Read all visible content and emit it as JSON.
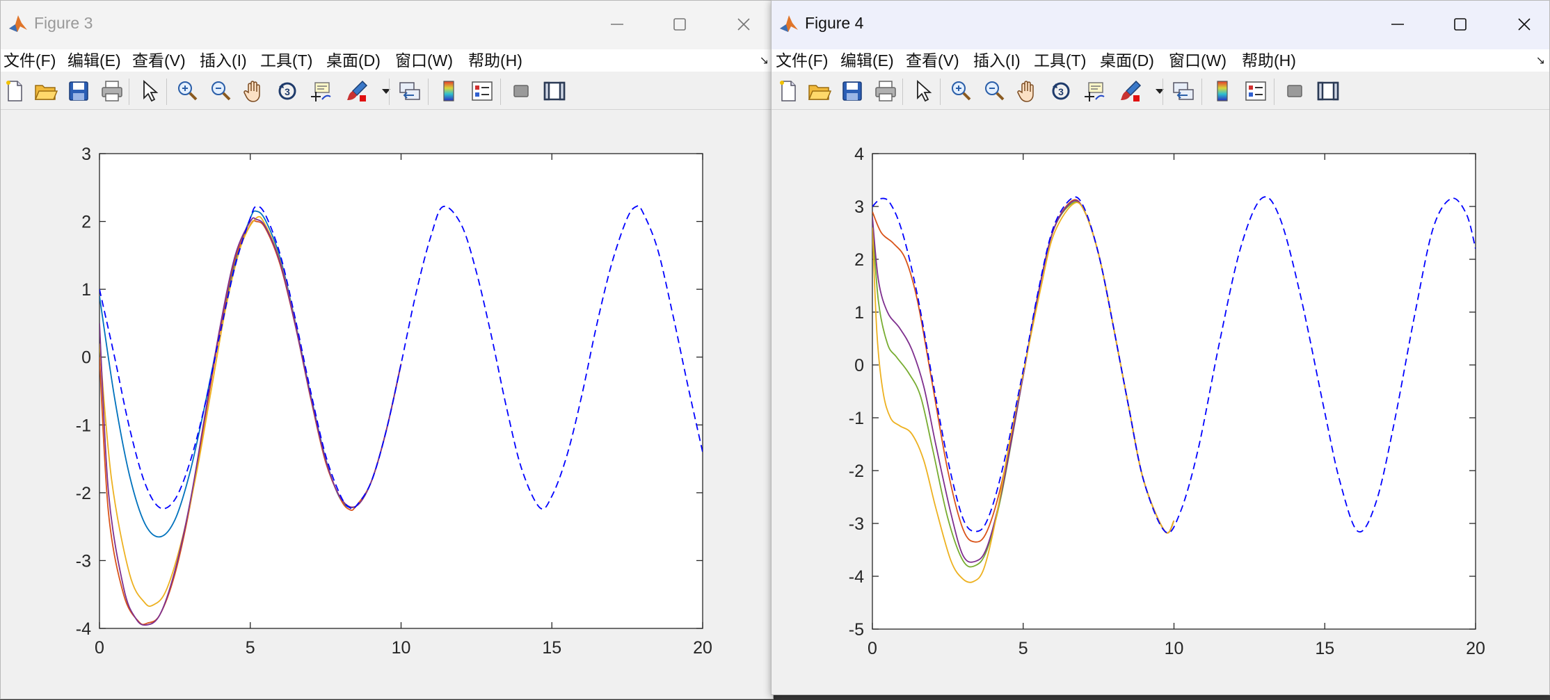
{
  "figures": [
    {
      "title": "Figure 3",
      "menu": [
        "文件(F)",
        "编辑(E)",
        "查看(V)",
        "插入(I)",
        "工具(T)",
        "桌面(D)",
        "窗口(W)",
        "帮助(H)"
      ],
      "toolbar": [
        "new-figure-icon",
        "open-file-icon",
        "save-icon",
        "print-icon",
        "pointer-icon",
        "zoom-in-icon",
        "zoom-out-icon",
        "pan-hand-icon",
        "rotate-3d-icon",
        "data-cursor-icon",
        "brush-icon",
        "brush-dropdown-icon",
        "link-plot-icon",
        "colorbar-icon",
        "legend-icon",
        "hide-plot-tools-icon",
        "show-plot-tools-icon"
      ],
      "controls": [
        "minimize-icon",
        "maximize-icon",
        "close-icon"
      ]
    },
    {
      "title": "Figure 4",
      "menu": [
        "文件(F)",
        "编辑(E)",
        "查看(V)",
        "插入(I)",
        "工具(T)",
        "桌面(D)",
        "窗口(W)",
        "帮助(H)"
      ],
      "toolbar": [
        "new-figure-icon",
        "open-file-icon",
        "save-icon",
        "print-icon",
        "pointer-icon",
        "zoom-in-icon",
        "zoom-out-icon",
        "pan-hand-icon",
        "rotate-3d-icon",
        "data-cursor-icon",
        "brush-icon",
        "brush-dropdown-icon",
        "link-plot-icon",
        "colorbar-icon",
        "legend-icon",
        "hide-plot-tools-icon",
        "show-plot-tools-icon"
      ],
      "controls": [
        "minimize-icon",
        "maximize-icon",
        "close-icon"
      ]
    }
  ],
  "chart_data": [
    {
      "type": "line",
      "title": "",
      "xlabel": "",
      "ylabel": "",
      "xlim": [
        0,
        20
      ],
      "ylim": [
        -4,
        3
      ],
      "xticks": [
        0,
        5,
        10,
        15,
        20
      ],
      "yticks": [
        -4,
        -3,
        -2,
        -1,
        0,
        1,
        2,
        3
      ],
      "grid": false,
      "series": [
        {
          "color": "#0000ff",
          "dash": true,
          "x": [
            0,
            0.5,
            1,
            1.5,
            2,
            2.5,
            3,
            3.5,
            4,
            4.5,
            5,
            5.2,
            5.5,
            6,
            6.5,
            7,
            7.5,
            8,
            8.3,
            8.5,
            9,
            9.5,
            10,
            10.5,
            11,
            11.4,
            12,
            12.5,
            13,
            13.5,
            14,
            14.6,
            15,
            15.5,
            16,
            16.5,
            17,
            17.5,
            17.8,
            18,
            18.5,
            19,
            19.5,
            20
          ],
          "y": [
            1,
            0,
            -1.05,
            -1.85,
            -2.22,
            -2.1,
            -1.55,
            -0.7,
            0.35,
            1.35,
            2.05,
            2.22,
            2.1,
            1.5,
            0.55,
            -0.5,
            -1.45,
            -2.05,
            -2.22,
            -2.2,
            -1.85,
            -1.1,
            -0.1,
            0.95,
            1.8,
            2.22,
            1.95,
            1.25,
            0.3,
            -0.75,
            -1.65,
            -2.22,
            -2.05,
            -1.45,
            -0.55,
            0.5,
            1.4,
            2.05,
            2.22,
            2.15,
            1.6,
            0.65,
            -0.4,
            -1.4
          ]
        },
        {
          "color": "#0072bd",
          "dash": false,
          "x": [
            0,
            0.5,
            1,
            1.5,
            2,
            2.5,
            3,
            3.5,
            4,
            4.5,
            5,
            5.2,
            5.5,
            6,
            6.5,
            7,
            7.5,
            8,
            8.5,
            9,
            9.5,
            10
          ],
          "y": [
            0.9,
            -0.6,
            -1.75,
            -2.45,
            -2.65,
            -2.4,
            -1.7,
            -0.7,
            0.4,
            1.4,
            2.05,
            2.15,
            2.02,
            1.45,
            0.5,
            -0.55,
            -1.5,
            -2.1,
            -2.2,
            -1.85,
            -1.1,
            -0.1
          ]
        },
        {
          "color": "#d95319",
          "dash": false,
          "x": [
            0,
            0.3,
            0.8,
            1.3,
            1.6,
            2,
            2.5,
            3,
            3.5,
            4,
            4.5,
            5,
            5.2,
            5.5,
            6,
            6.5,
            7,
            7.5,
            8,
            8.3,
            8.5,
            9,
            9.5,
            10
          ],
          "y": [
            0,
            -2.3,
            -3.5,
            -3.9,
            -3.92,
            -3.8,
            -3.2,
            -2.2,
            -0.9,
            0.4,
            1.45,
            1.95,
            2.0,
            1.9,
            1.35,
            0.45,
            -0.6,
            -1.55,
            -2.1,
            -2.25,
            -2.2,
            -1.85,
            -1.1,
            -0.1
          ]
        },
        {
          "color": "#edb120",
          "dash": false,
          "x": [
            0,
            0.4,
            1,
            1.5,
            1.8,
            2.2,
            2.7,
            3.2,
            3.7,
            4.2,
            4.7,
            5.2,
            5.5,
            6,
            6.5,
            7,
            7.5,
            8,
            8.5,
            9,
            9.5,
            10
          ],
          "y": [
            0.2,
            -1.8,
            -3.2,
            -3.62,
            -3.65,
            -3.45,
            -2.75,
            -1.75,
            -0.5,
            0.75,
            1.65,
            2.05,
            1.95,
            1.4,
            0.48,
            -0.58,
            -1.52,
            -2.08,
            -2.2,
            -1.85,
            -1.1,
            -0.1
          ]
        },
        {
          "color": "#7e2f8e",
          "dash": false,
          "x": [
            0,
            0.3,
            0.8,
            1.2,
            1.55,
            2,
            2.5,
            3,
            3.5,
            4,
            4.5,
            5,
            5.2,
            5.5,
            6,
            6.5,
            7,
            7.5,
            8,
            8.5,
            9,
            9.5,
            10
          ],
          "y": [
            0.5,
            -2.0,
            -3.4,
            -3.85,
            -3.95,
            -3.8,
            -3.15,
            -2.15,
            -0.85,
            0.45,
            1.5,
            2.0,
            2.03,
            1.92,
            1.38,
            0.46,
            -0.58,
            -1.52,
            -2.08,
            -2.2,
            -1.85,
            -1.1,
            -0.1
          ]
        }
      ]
    },
    {
      "type": "line",
      "title": "",
      "xlabel": "",
      "ylabel": "",
      "xlim": [
        0,
        20
      ],
      "ylim": [
        -5,
        4
      ],
      "xticks": [
        0,
        5,
        10,
        15,
        20
      ],
      "yticks": [
        -5,
        -4,
        -3,
        -2,
        -1,
        0,
        1,
        2,
        3,
        4
      ],
      "grid": false,
      "series": [
        {
          "color": "#0000ff",
          "dash": true,
          "x": [
            0,
            0.3,
            0.6,
            1,
            1.5,
            2,
            2.5,
            3,
            3.4,
            3.8,
            4.3,
            5,
            5.5,
            6,
            6.6,
            7,
            7.5,
            8,
            8.5,
            9,
            9.7,
            10.2,
            10.8,
            11.5,
            12.2,
            12.9,
            13.5,
            14.2,
            15,
            15.5,
            16.1,
            16.7,
            17.3,
            18,
            18.6,
            19.2,
            19.7,
            20
          ],
          "y": [
            3.0,
            3.15,
            3.05,
            2.5,
            1.3,
            -0.3,
            -1.8,
            -2.9,
            -3.15,
            -2.95,
            -2.0,
            -0.1,
            1.4,
            2.6,
            3.15,
            3.0,
            2.1,
            0.7,
            -0.8,
            -2.2,
            -3.15,
            -2.8,
            -1.6,
            0.4,
            2.2,
            3.15,
            2.8,
            1.3,
            -0.9,
            -2.2,
            -3.15,
            -2.6,
            -1.1,
            1.0,
            2.6,
            3.15,
            2.85,
            2.2
          ]
        },
        {
          "color": "#d95319",
          "dash": false,
          "x": [
            0,
            0.3,
            0.7,
            1.1,
            1.5,
            2,
            2.5,
            3,
            3.4,
            3.8,
            4.3,
            5,
            5.5,
            6,
            6.6,
            7,
            7.5,
            8,
            8.5,
            9,
            9.7,
            10
          ],
          "y": [
            2.9,
            2.5,
            2.3,
            2.0,
            1.2,
            -0.4,
            -2.0,
            -3.1,
            -3.35,
            -3.15,
            -2.2,
            -0.2,
            1.35,
            2.55,
            3.1,
            2.95,
            2.1,
            0.7,
            -0.8,
            -2.2,
            -3.15,
            -2.95
          ]
        },
        {
          "color": "#77ac30",
          "dash": false,
          "x": [
            0,
            0.2,
            0.5,
            0.8,
            1.2,
            1.6,
            2,
            2.5,
            3,
            3.4,
            3.8,
            4.3,
            5,
            5.5,
            6,
            6.6,
            7,
            7.5,
            8,
            8.5,
            9,
            9.7,
            10
          ],
          "y": [
            2.7,
            1.2,
            0.4,
            0.15,
            -0.15,
            -0.6,
            -1.6,
            -2.9,
            -3.7,
            -3.8,
            -3.5,
            -2.4,
            -0.2,
            1.35,
            2.55,
            3.05,
            2.95,
            2.1,
            0.7,
            -0.8,
            -2.2,
            -3.15,
            -2.95
          ]
        },
        {
          "color": "#7e2f8e",
          "dash": false,
          "x": [
            0,
            0.2,
            0.5,
            0.9,
            1.3,
            1.7,
            2.1,
            2.6,
            3,
            3.4,
            3.8,
            4.3,
            5,
            5.5,
            6,
            6.6,
            7,
            7.5,
            8,
            8.5,
            9,
            9.7,
            10
          ],
          "y": [
            2.8,
            1.6,
            1.0,
            0.7,
            0.3,
            -0.4,
            -1.5,
            -2.8,
            -3.6,
            -3.72,
            -3.45,
            -2.35,
            -0.2,
            1.35,
            2.55,
            3.08,
            2.95,
            2.1,
            0.7,
            -0.8,
            -2.2,
            -3.15,
            -2.95
          ]
        },
        {
          "color": "#edb120",
          "dash": false,
          "x": [
            0,
            0.15,
            0.35,
            0.6,
            0.9,
            1.3,
            1.7,
            2.1,
            2.6,
            3,
            3.35,
            3.7,
            4.1,
            4.6,
            5.2,
            5.6,
            6,
            6.6,
            7,
            7.5,
            8,
            8.5,
            9,
            9.7,
            10
          ],
          "y": [
            2.6,
            0.6,
            -0.5,
            -1.0,
            -1.15,
            -1.3,
            -1.8,
            -2.7,
            -3.7,
            -4.05,
            -4.1,
            -3.85,
            -2.9,
            -1.3,
            0.4,
            1.5,
            2.45,
            3.02,
            2.95,
            2.1,
            0.7,
            -0.8,
            -2.2,
            -3.15,
            -2.95
          ]
        }
      ]
    }
  ]
}
